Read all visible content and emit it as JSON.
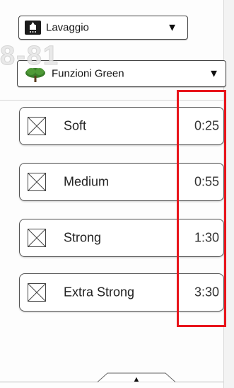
{
  "top_dropdown": {
    "label": "Lavaggio",
    "arrow": "▼",
    "icon": "washing-icon"
  },
  "watermark": "8-81",
  "green_dropdown": {
    "label": "Funzioni Green",
    "arrow": "▼",
    "icon": "tree-icon",
    "icon_color": "#3a7d2a"
  },
  "options": [
    {
      "name": "Soft",
      "time": "0:25",
      "checked": false
    },
    {
      "name": "Medium",
      "time": "0:55",
      "checked": false
    },
    {
      "name": "Strong",
      "time": "1:30",
      "checked": false
    },
    {
      "name": "Extra Strong",
      "time": "3:30",
      "checked": false
    }
  ],
  "highlight_color": "#e8141b",
  "bottom_tab": {
    "arrow": "▲"
  }
}
